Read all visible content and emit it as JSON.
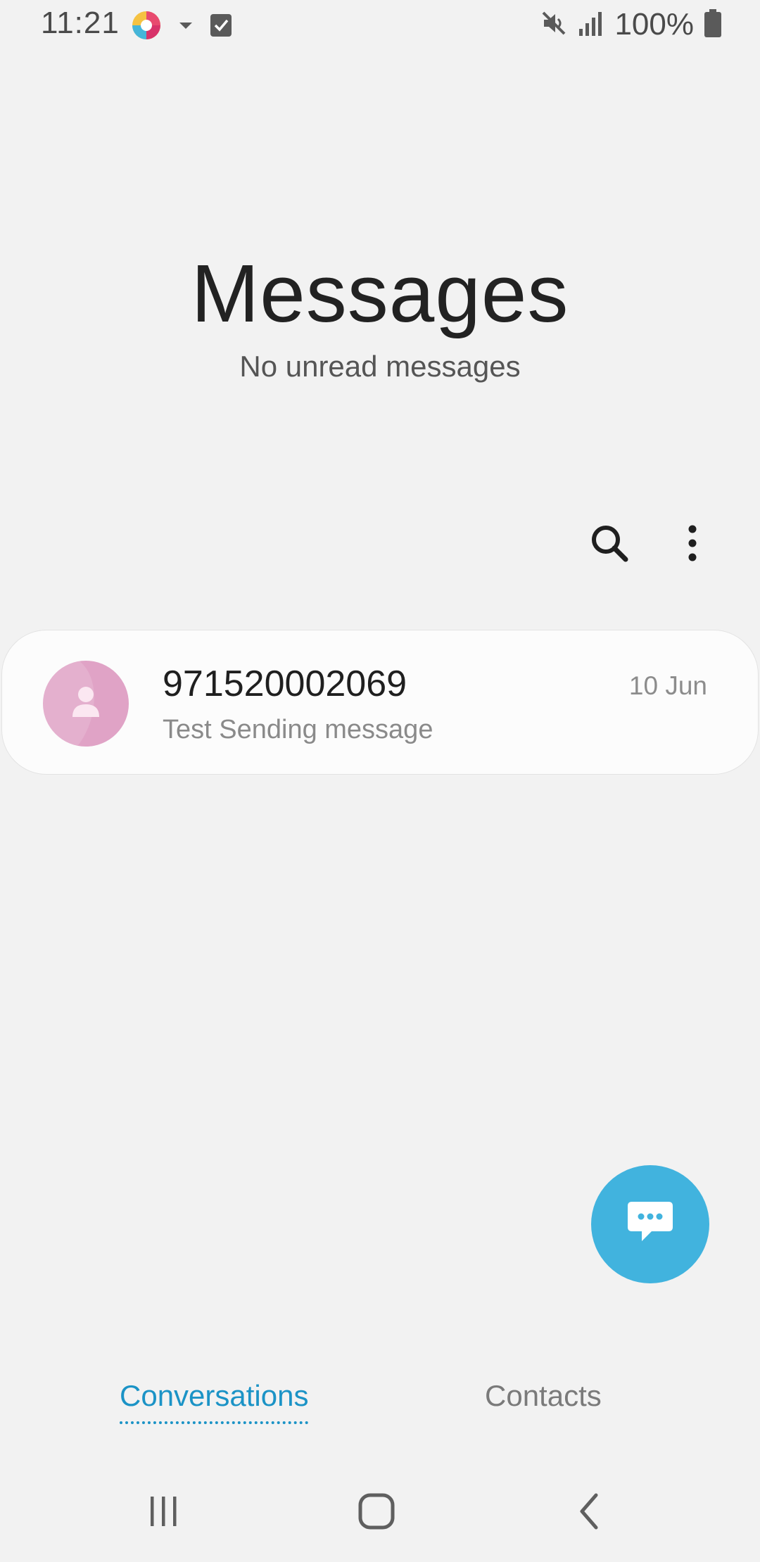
{
  "status_bar": {
    "time": "11:21",
    "battery": "100%",
    "icons": [
      "app-notification-icon",
      "dropdown-arrow-icon",
      "checkbox-notification-icon",
      "mute-icon",
      "signal-icon",
      "battery-icon"
    ]
  },
  "header": {
    "title": "Messages",
    "subtitle": "No unread messages"
  },
  "toolbar": {
    "icons": [
      "search-icon",
      "more-options-icon"
    ]
  },
  "conversations": [
    {
      "name": "971520002069",
      "snippet": "Test Sending message",
      "date": "10 Jun",
      "avatar_color": "#e0a3c6"
    }
  ],
  "fab": {
    "icon": "compose-message-icon",
    "color": "#41b3de"
  },
  "tabs": [
    {
      "label": "Conversations",
      "active": true
    },
    {
      "label": "Contacts",
      "active": false
    }
  ],
  "nav_bar": {
    "icons": [
      "recent-apps-icon",
      "home-icon",
      "back-icon"
    ]
  },
  "colors": {
    "background": "#f2f2f2",
    "accent": "#1b93c6"
  }
}
